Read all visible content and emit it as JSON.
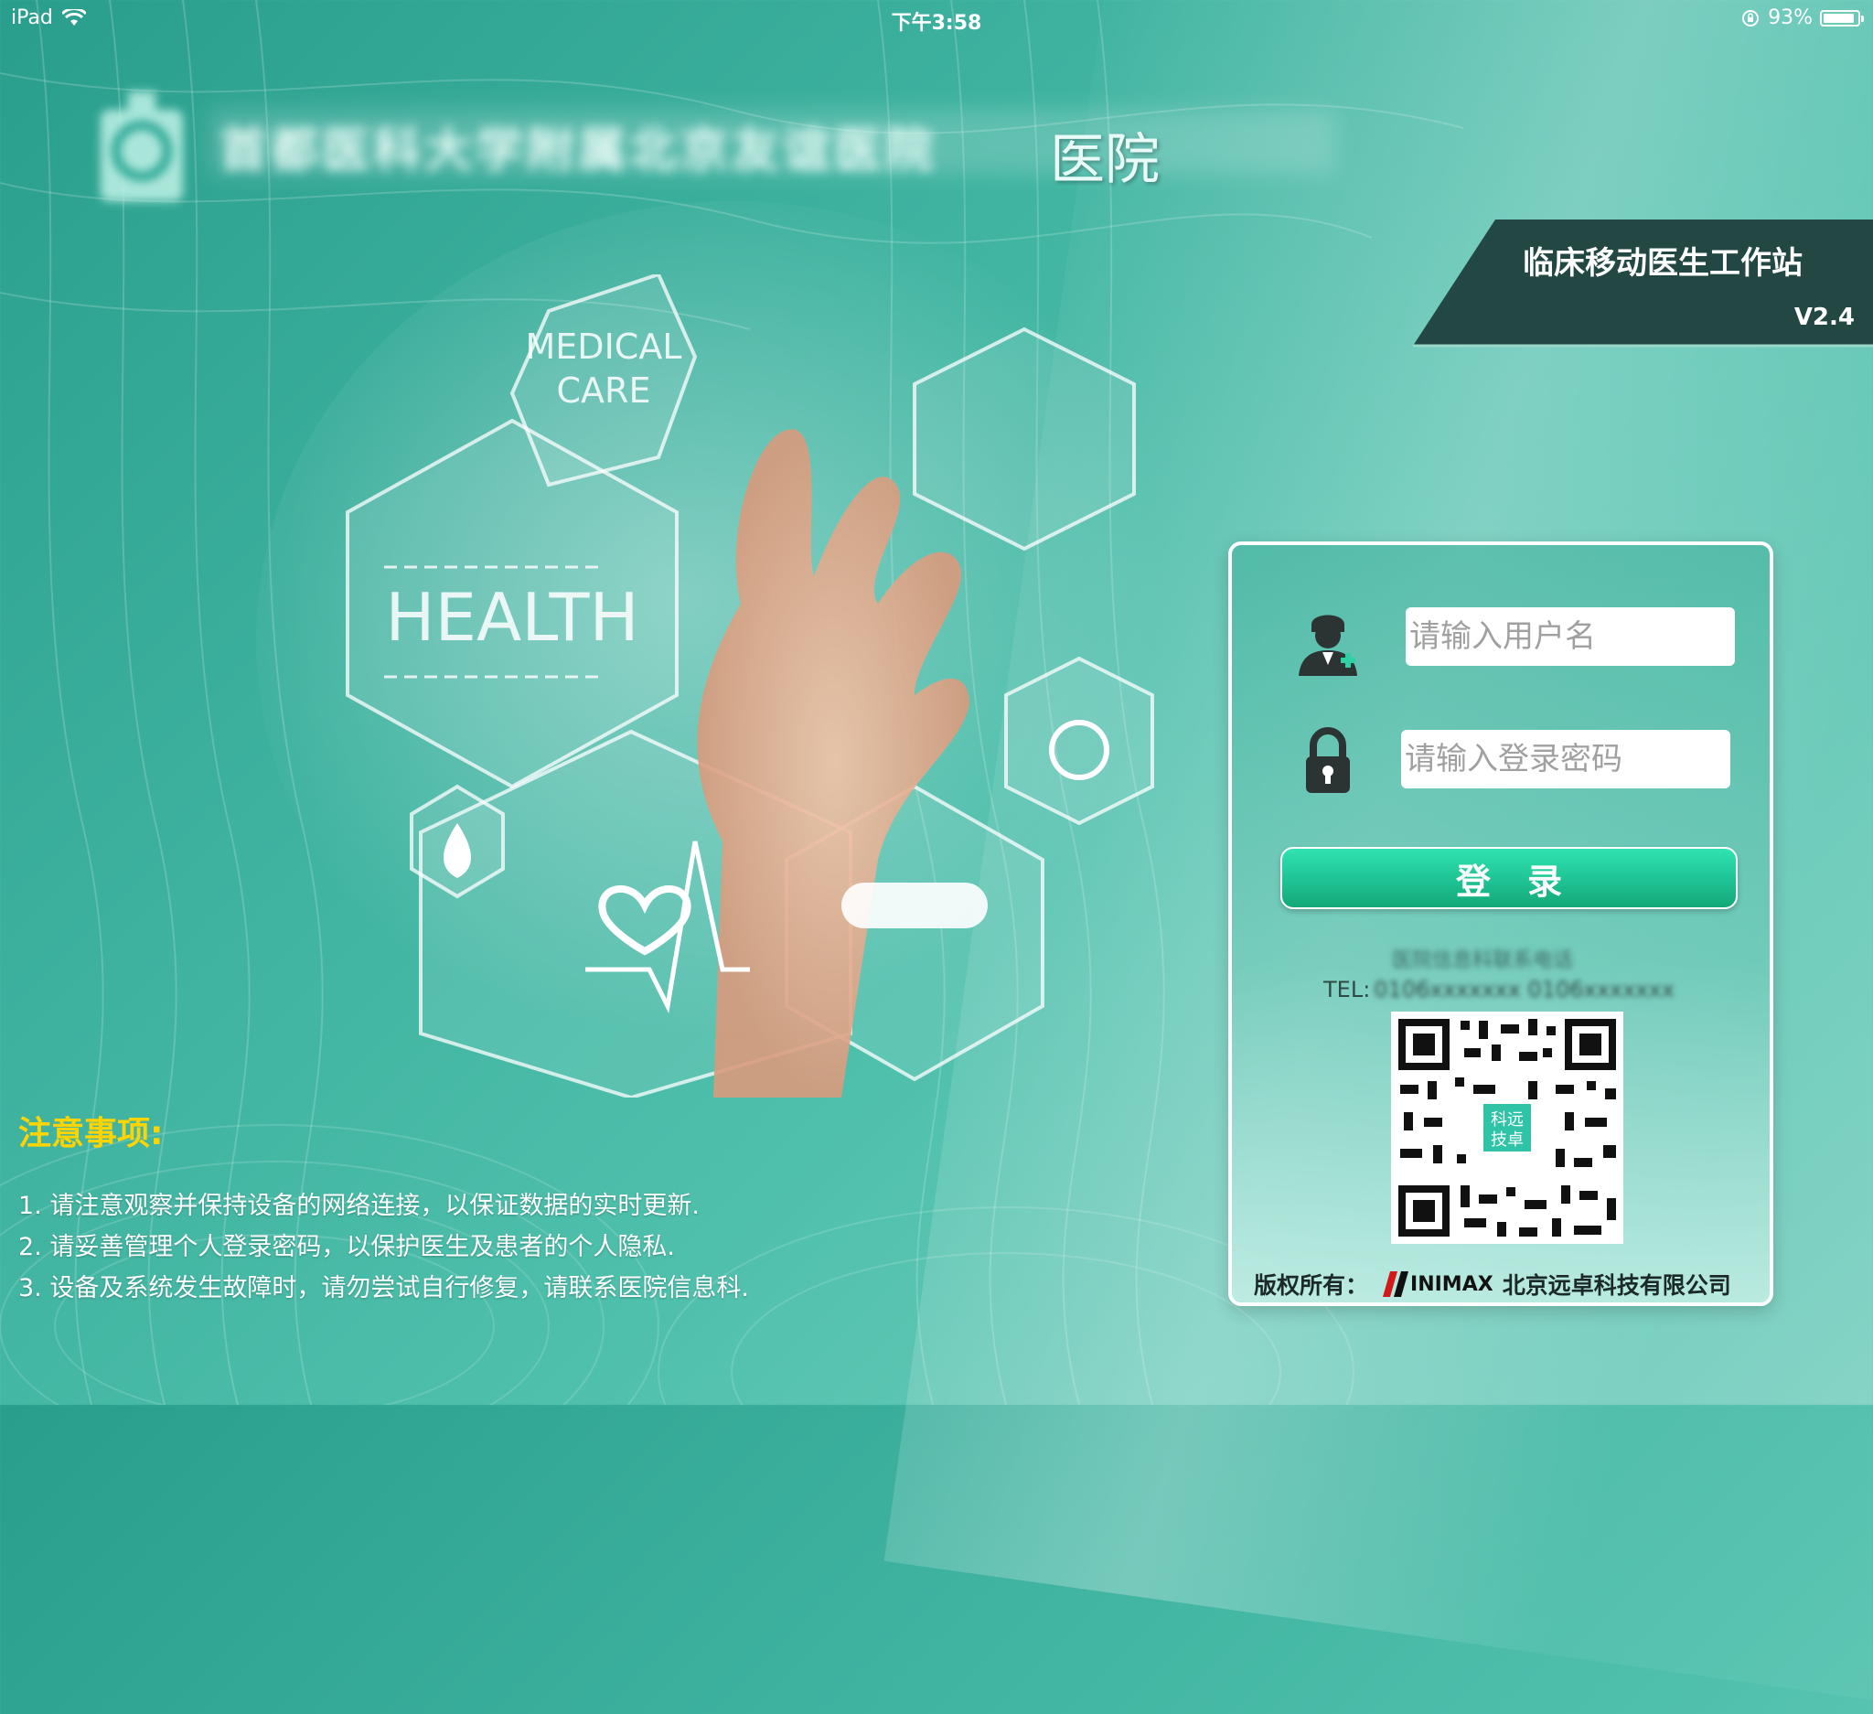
{
  "status_bar": {
    "device": "iPad",
    "time": "下午3:58",
    "battery": "93%",
    "battery_level": 0.93
  },
  "header": {
    "hospital_name_blurred": "首都医科大学附属北京友谊医院",
    "hospital_name_visible": "医院"
  },
  "banner": {
    "title": "临床移动医生工作站",
    "version": "V2.4"
  },
  "artwork": {
    "medical_care_line1": "MEDICAL",
    "medical_care_line2": "CARE",
    "health": "HEALTH"
  },
  "notice": {
    "title": "注意事项:",
    "items": [
      "1. 请注意观察并保持设备的网络连接，以保证数据的实时更新.",
      "2. 请妥善管理个人登录密码，以保护医生及患者的个人隐私.",
      "3. 设备及系统发生故障时，请勿尝试自行修复，请联系医院信息科."
    ]
  },
  "login": {
    "username_placeholder": "请输入用户名",
    "password_placeholder": "请输入登录密码",
    "button_label": "登录",
    "contact_blurred": "医院信息科联系电话",
    "tel_label": "TEL:",
    "tel_blurred": "0106xxxxxxx  0106xxxxxxx",
    "qr_center_text": "科远技卓",
    "copyright_label": "版权所有：",
    "brand": "INIMAX",
    "company": "北京远卓科技有限公司"
  }
}
